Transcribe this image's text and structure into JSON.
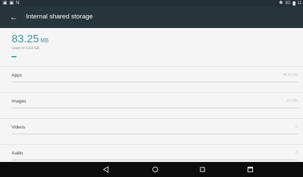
{
  "status_bar": {
    "left_icons": [
      "gallery-icon",
      "gallery-icon",
      "notification-n-icon"
    ],
    "left_glyphs": [
      "▣",
      "▣",
      "N"
    ],
    "bluetooth_glyph": "✱",
    "signal_text": "3G",
    "time_text": "11"
  },
  "app_bar": {
    "back_glyph": "←",
    "title": "Internal shared storage"
  },
  "summary": {
    "used_value": "83.25",
    "used_unit": "MB",
    "used_of": "Used of 4.64 GB",
    "used_fraction": 0.0175,
    "accent_color": "#3b95a3",
    "bar_color": "#2ab0a0"
  },
  "categories": [
    {
      "label": "Apps",
      "size": "44.39 MB"
    },
    {
      "label": "Images",
      "size": "512 KB"
    },
    {
      "label": "Videos",
      "size": "0"
    },
    {
      "label": "Audio",
      "size": "0"
    }
  ],
  "nav": {
    "back": "triangle-back-icon",
    "home": "circle-home-icon",
    "recents": "square-recents-icon",
    "screenshot": "screenshot-icon"
  }
}
